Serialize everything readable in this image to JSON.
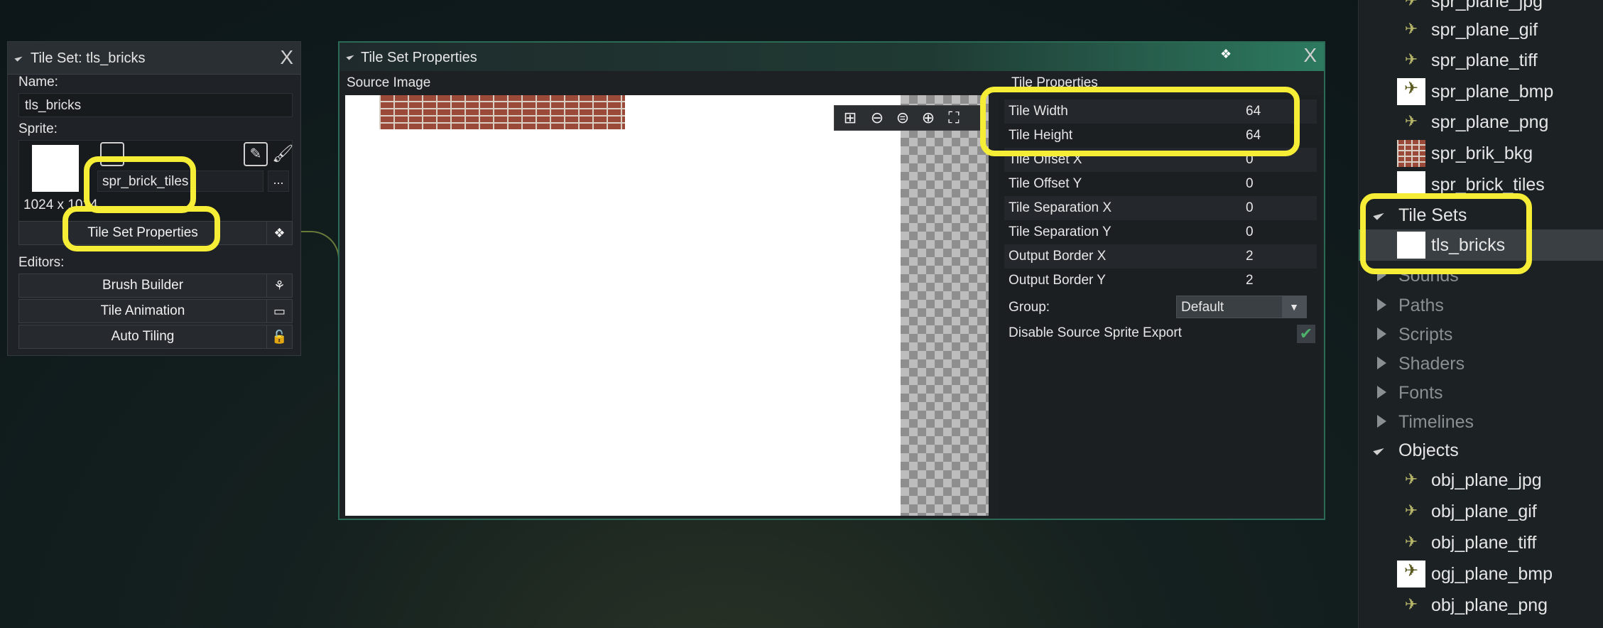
{
  "tileset_panel": {
    "title": "Tile Set: tls_bricks",
    "close": "X",
    "name_label": "Name:",
    "name_value": "tls_bricks",
    "sprite_label": "Sprite:",
    "sprite_name": "spr_brick_tiles",
    "sprite_dims": "1024 x 1024",
    "more_button": "...",
    "properties_button": "Tile Set Properties",
    "editors_label": "Editors:",
    "editors": [
      {
        "label": "Brush Builder",
        "icon": "brush-icon"
      },
      {
        "label": "Tile Animation",
        "icon": "film-icon"
      },
      {
        "label": "Auto Tiling",
        "icon": "lock-icon"
      }
    ]
  },
  "window": {
    "title": "Tile Set Properties",
    "close": "X",
    "source_image_label": "Source Image",
    "tile_properties_label": "Tile Properties",
    "properties": [
      {
        "key": "Tile Width",
        "value": "64"
      },
      {
        "key": "Tile Height",
        "value": "64"
      },
      {
        "key": "Tile Offset X",
        "value": "0"
      },
      {
        "key": "Tile Offset Y",
        "value": "0"
      },
      {
        "key": "Tile Separation X",
        "value": "0"
      },
      {
        "key": "Tile Separation Y",
        "value": "0"
      },
      {
        "key": "Output Border X",
        "value": "2"
      },
      {
        "key": "Output Border Y",
        "value": "2"
      }
    ],
    "group_label": "Group:",
    "group_value": "Default",
    "disable_export_label": "Disable Source Sprite Export",
    "disable_export_checked": true,
    "toolbar_icons": [
      "grid-icon",
      "zoom-out-icon",
      "zoom-reset-icon",
      "zoom-in-icon",
      "fullscreen-icon"
    ]
  },
  "tree": {
    "sprites": [
      {
        "name": "spr_plane_jpg",
        "icon": "plane-icon"
      },
      {
        "name": "spr_plane_gif",
        "icon": "plane-icon"
      },
      {
        "name": "spr_plane_tiff",
        "icon": "plane-icon"
      },
      {
        "name": "spr_plane_bmp",
        "icon": "plane-thumb"
      },
      {
        "name": "spr_plane_png",
        "icon": "plane-icon"
      },
      {
        "name": "spr_brik_bkg",
        "icon": "brick-thumb"
      },
      {
        "name": "spr_brick_tiles",
        "icon": "white-thumb"
      }
    ],
    "tile_sets_label": "Tile Sets",
    "tile_set_item": "tls_bricks",
    "sounds_label": "Sounds",
    "collapsed_groups": [
      "Paths",
      "Scripts",
      "Shaders",
      "Fonts",
      "Timelines"
    ],
    "objects_label": "Objects",
    "objects": [
      {
        "name": "obj_plane_jpg",
        "icon": "plane-icon"
      },
      {
        "name": "obj_plane_gif",
        "icon": "plane-icon"
      },
      {
        "name": "obj_plane_tiff",
        "icon": "plane-icon"
      },
      {
        "name": "ogj_plane_bmp",
        "icon": "plane-thumb"
      },
      {
        "name": "obj_plane_png",
        "icon": "plane-icon"
      }
    ]
  },
  "colors": {
    "highlight": "#f6ee36",
    "accent_green": "#2d7a60",
    "panel_bg": "#1f2327"
  }
}
